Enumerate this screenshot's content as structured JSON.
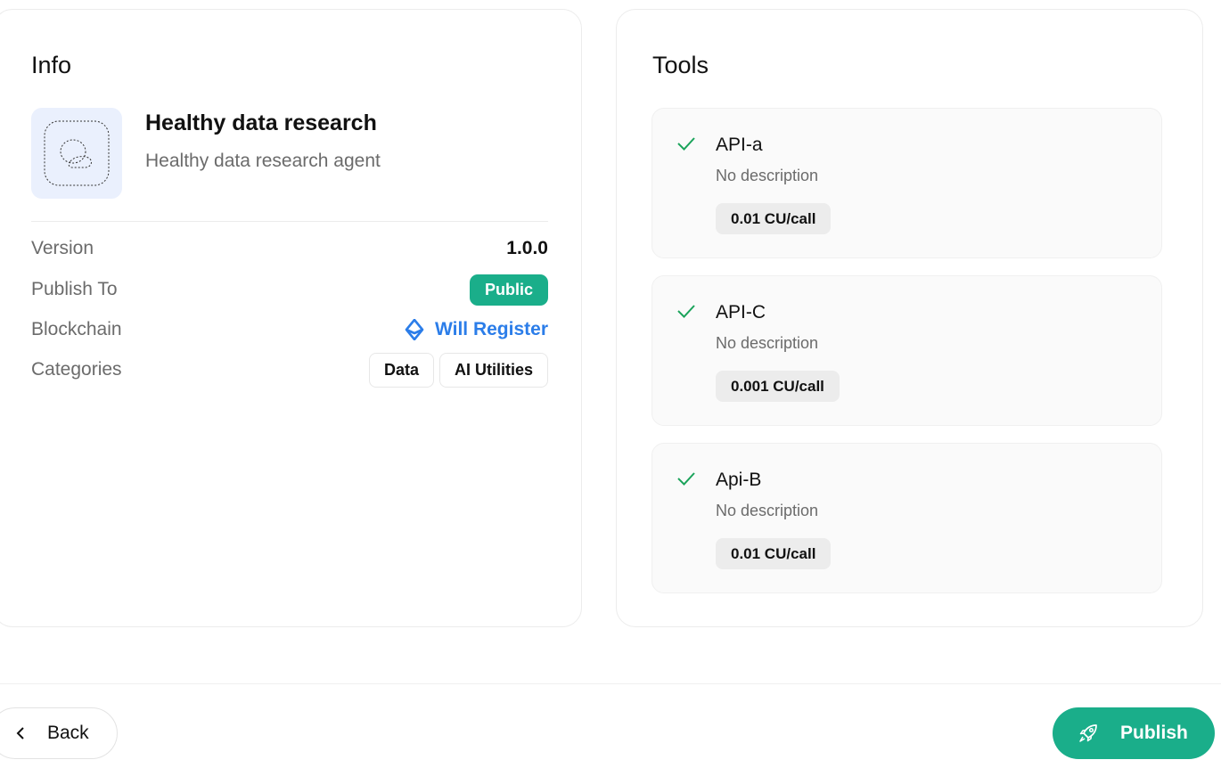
{
  "info": {
    "title": "Info",
    "agent": {
      "name": "Healthy data research",
      "description": "Healthy data research agent",
      "avatar_icon": "chat-bubbles-icon"
    },
    "rows": {
      "version": {
        "label": "Version",
        "value": "1.0.0"
      },
      "publish_to": {
        "label": "Publish To",
        "value": "Public"
      },
      "blockchain": {
        "label": "Blockchain",
        "value": "Will Register",
        "icon": "ethereum-icon"
      },
      "categories": {
        "label": "Categories",
        "values": [
          "Data",
          "AI Utilities"
        ]
      }
    }
  },
  "tools": {
    "title": "Tools",
    "items": [
      {
        "name": "API-a",
        "description": "No description",
        "price": "0.01 CU/call"
      },
      {
        "name": "API-C",
        "description": "No description",
        "price": "0.001 CU/call"
      },
      {
        "name": "Api-B",
        "description": "No description",
        "price": "0.01 CU/call"
      }
    ]
  },
  "footer": {
    "back_label": "Back",
    "publish_label": "Publish"
  },
  "colors": {
    "accent": "#1aae8a",
    "link": "#2b7de9",
    "check": "#1aa35a"
  }
}
